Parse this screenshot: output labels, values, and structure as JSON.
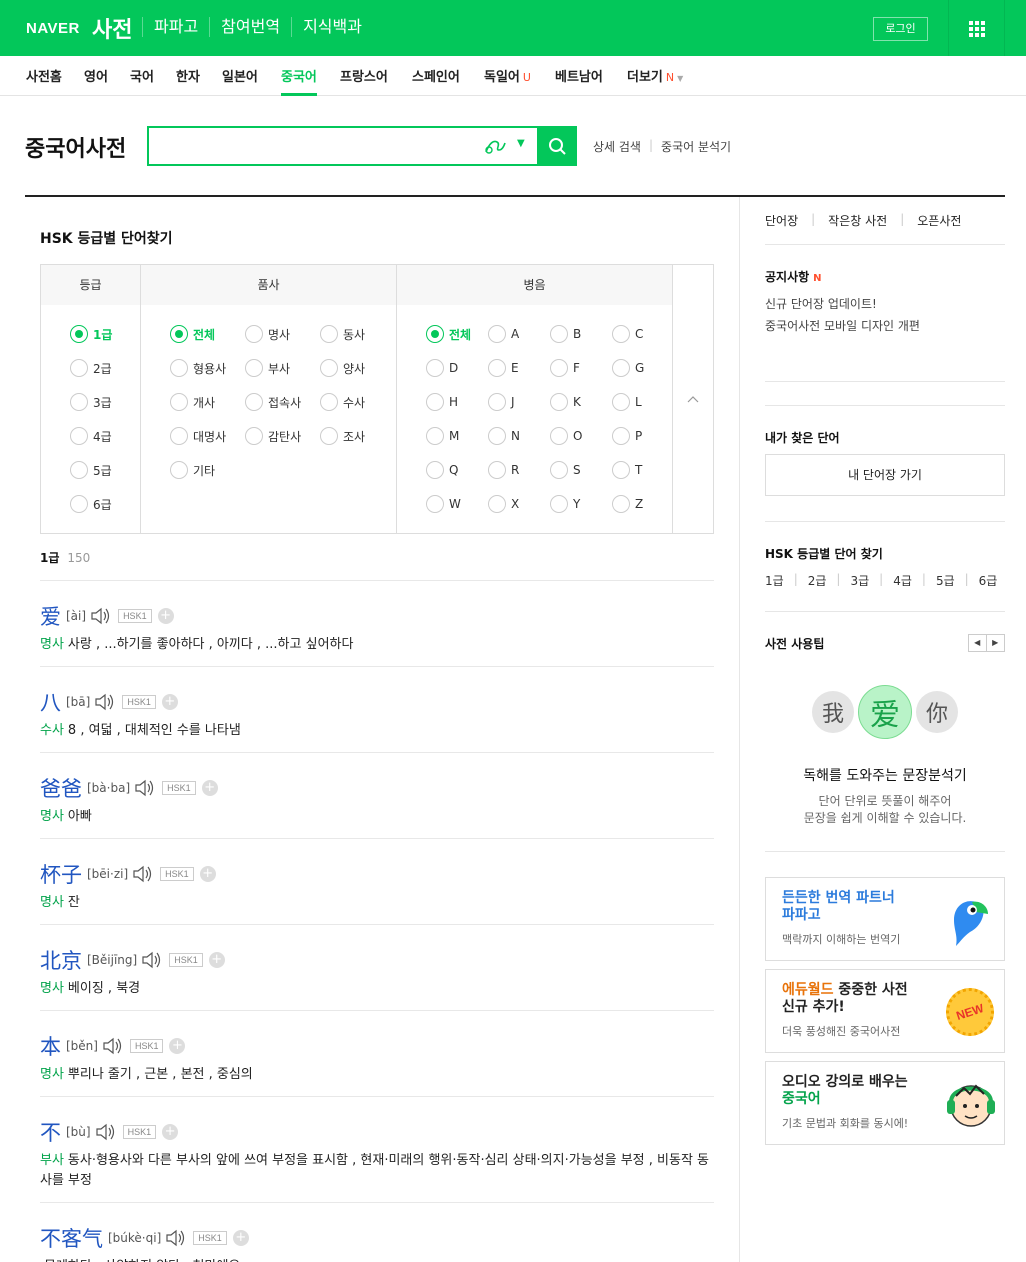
{
  "header": {
    "brand": "NAVER",
    "service": "사전",
    "nav": [
      "파파고",
      "참여번역",
      "지식백과"
    ],
    "login_label": "로그인"
  },
  "dictnav": [
    {
      "label": "사전홈",
      "active": false
    },
    {
      "label": "영어",
      "active": false
    },
    {
      "label": "국어",
      "active": false
    },
    {
      "label": "한자",
      "active": false
    },
    {
      "label": "일본어",
      "active": false
    },
    {
      "label": "중국어",
      "active": true
    },
    {
      "label": "프랑스어",
      "active": false
    },
    {
      "label": "스페인어",
      "active": false
    },
    {
      "label": "독일어",
      "sup": "U",
      "active": false
    },
    {
      "label": "베트남어",
      "active": false
    },
    {
      "label": "더보기",
      "sup": "N",
      "active": false
    }
  ],
  "search": {
    "title": "중국어사전",
    "value": "",
    "links": [
      "상세 검색",
      "중국어 분석기"
    ]
  },
  "hsk_finder": {
    "title": "HSK 등급별 단어찾기",
    "columns": [
      "등급",
      "품사",
      "병음"
    ],
    "levels": [
      "1급",
      "2급",
      "3급",
      "4급",
      "5급",
      "6급"
    ],
    "pos": [
      "전체",
      "명사",
      "동사",
      "형용사",
      "부사",
      "양사",
      "개사",
      "접속사",
      "수사",
      "대명사",
      "감탄사",
      "조사",
      "기타"
    ],
    "pinyin": [
      "전체",
      "A",
      "B",
      "C",
      "D",
      "E",
      "F",
      "G",
      "H",
      "J",
      "K",
      "L",
      "M",
      "N",
      "O",
      "P",
      "Q",
      "R",
      "S",
      "T",
      "W",
      "X",
      "Y",
      "Z"
    ],
    "selected_level": "1급",
    "count": "150"
  },
  "entries": [
    {
      "word": "爱",
      "pinyin": "[ài]",
      "hsk": "HSK1",
      "pos": "명사",
      "def": "사랑 , ...하기를 좋아하다 , 아끼다 , ...하고 싶어하다"
    },
    {
      "word": "八",
      "pinyin": "[bā]",
      "hsk": "HSK1",
      "pos": "수사",
      "def": "8 , 여덟 , 대체적인 수를 나타냄"
    },
    {
      "word": "爸爸",
      "pinyin": "[bà·ba]",
      "hsk": "HSK1",
      "pos": "명사",
      "def": "아빠"
    },
    {
      "word": "杯子",
      "pinyin": "[bēi·zi]",
      "hsk": "HSK1",
      "pos": "명사",
      "def": "잔"
    },
    {
      "word": "北京",
      "pinyin": "[Běijīng]",
      "hsk": "HSK1",
      "pos": "명사",
      "def": "베이징 , 북경"
    },
    {
      "word": "本",
      "pinyin": "[běn]",
      "hsk": "HSK1",
      "pos": "명사",
      "def": "뿌리나 줄기 , 근본 , 본전 , 중심의"
    },
    {
      "word": "不",
      "pinyin": "[bù]",
      "hsk": "HSK1",
      "pos": "부사",
      "def": "동사·형용사와 다른 부사의 앞에 쓰여 부정을 표시함 , 현재·미래의 행위·동작·심리 상태·의지·가능성을 부정 , 비동작 동사를 부정"
    },
    {
      "word": "不客气",
      "pinyin": "[búkè·qi]",
      "hsk": "HSK1",
      "pos": "",
      "def": "무례하다 , 사양하지 않다 , 천만에요"
    }
  ],
  "sidebar": {
    "tabs": [
      "단어장",
      "작은창 사전",
      "오픈사전"
    ],
    "notice_title": "공지사항",
    "notice_badge": "N",
    "notices": [
      "신규 단어장 업데이트!",
      "중국어사전 모바일 디자인 개편"
    ],
    "my_words_title": "내가 찾은 단어",
    "my_words_btn": "내 단어장 가기",
    "hsk_title": "HSK 등급별 단어 찾기",
    "hsk_links": [
      "1급",
      "2급",
      "3급",
      "4급",
      "5급",
      "6급"
    ],
    "tip_title": "사전 사용팁",
    "tip_chars": [
      "我",
      "爱",
      "你"
    ],
    "tip_main": "독해를 도와주는 문장분석기",
    "tip_sub1": "단어 단위로 뜻풀이 해주어",
    "tip_sub2": "문장을 쉽게 이해할 수 있습니다.",
    "promos": [
      {
        "title1": "든든한 번역 파트너",
        "title2": "파파고",
        "sub": "맥락까지 이해하는 번역기"
      },
      {
        "title1a": "에듀월드",
        "title1b": " 중중한 사전",
        "title2": "신규 추가!",
        "sub": "더욱 풍성해진 중국어사전",
        "badge": "NEW"
      },
      {
        "title1": "오디오 강의로 배우는",
        "title2": "중국어",
        "sub": "기초 문법과 회화를 동시에!"
      }
    ]
  },
  "colors": {
    "brand_green": "#03c75a",
    "link_blue": "#2156c0",
    "pos_green": "#03a34b"
  }
}
